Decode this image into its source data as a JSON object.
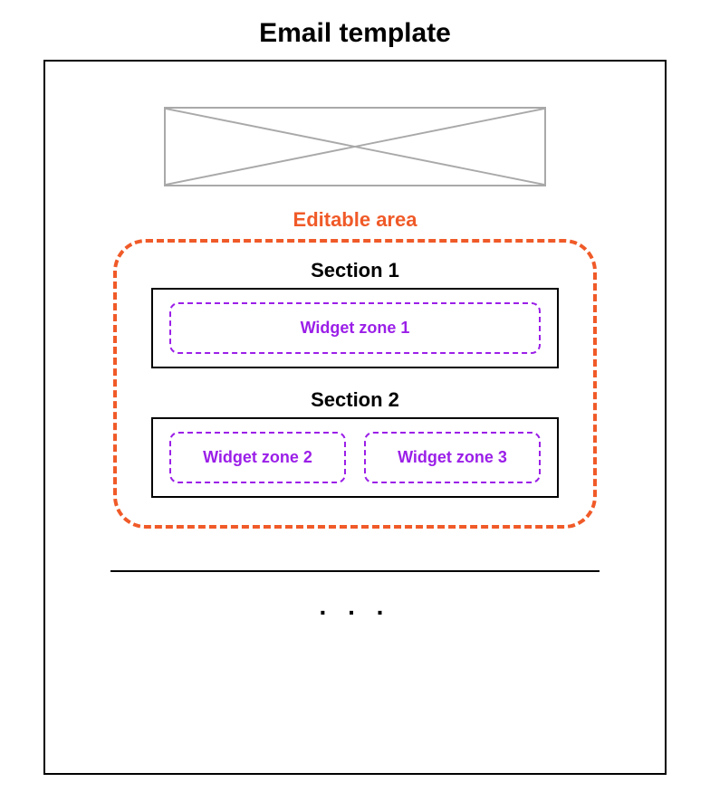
{
  "title": "Email template",
  "editable_area_label": "Editable area",
  "sections": [
    {
      "title": "Section 1",
      "zones": [
        "Widget zone 1"
      ]
    },
    {
      "title": "Section 2",
      "zones": [
        "Widget zone 2",
        "Widget zone 3"
      ]
    }
  ],
  "ellipsis": ". . .",
  "colors": {
    "editable_border": "#f05a28",
    "widget_border": "#9b1fe8"
  }
}
